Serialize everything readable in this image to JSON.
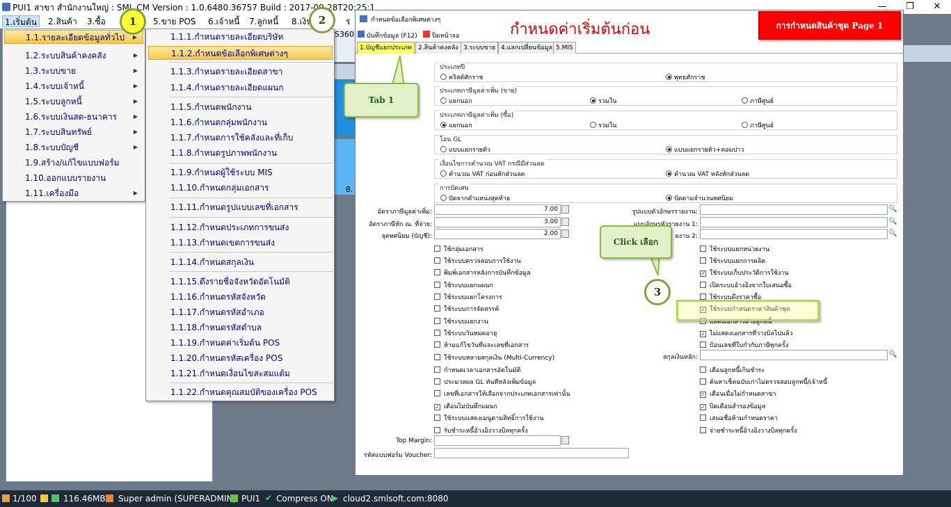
{
  "window": {
    "title": "PUI1 สาขา สำนักงานใหญ่ : SML CM Version : 1.0.6480.36757  Build : 2017-09-28T20:25:1"
  },
  "menubar": {
    "items": [
      {
        "label": "1.เริ่มต้น"
      },
      {
        "label": "2.สินค้า"
      },
      {
        "label": "3.ซื้อ"
      },
      {
        "label": "5.ขาย POS"
      },
      {
        "label": "6.เจ้าหนี้"
      },
      {
        "label": "7.ลูกหนี้"
      },
      {
        "label": "8.เงิน"
      },
      {
        "label": "ร"
      }
    ],
    "fragment": "S360"
  },
  "menu1": {
    "items": [
      {
        "label": "1.1.รายละเอียดข้อมูลทั่วไป",
        "sub": true
      },
      {
        "label": "1.2.ระบบสินค้าคงคลัง",
        "sub": true
      },
      {
        "label": "1.3.ระบบขาย",
        "sub": true
      },
      {
        "label": "1.4.ระบบเจ้าหนี้",
        "sub": true
      },
      {
        "label": "1.5.ระบบลูกหนี้",
        "sub": true
      },
      {
        "label": "1.6.ระบบเงินสด-ธนาคาร",
        "sub": true
      },
      {
        "label": "1.7.ระบบสินทรัพย์",
        "sub": true
      },
      {
        "label": "1.8.ระบบบัญชี",
        "sub": true
      },
      {
        "label": "1.9.สร้าง/แก้ไขแบบฟอร์ม",
        "sub": false
      },
      {
        "label": "1.10.ออกแบบรายงาน",
        "sub": false
      },
      {
        "label": "1.11.เครื่องมือ",
        "sub": true
      }
    ]
  },
  "menu2": {
    "items": [
      "1.1.1.กำหนดรายละเอียดบริษัท",
      "1.1.2.กำหนดข้อเลือกพิเศษต่างๆ",
      "1.1.3.กำหนดรายละเอียดสาขา",
      "1.1.4.กำหนดรายละเอียดแผนก",
      "1.1.5.กำหนดพนักงาน",
      "1.1.6.กำหนดกลุ่มพนักงาน",
      "1.1.7.กำหนดการใช้คลังและที่เก็บ",
      "1.1.8.กำหนดรูปภาพพนักงาน",
      "1.1.9.กำหนดผู้ใช้ระบบ MIS",
      "1.1.10.กำหนดกลุ่มเอกสาร",
      "1.1.11.กำหนดรูปแบบเลขที่เอกสาร",
      "1.1.12.กำหนดประเภทการขนส่ง",
      "1.1.13.กำหนดเขตการขนส่ง",
      "1.1.14.กำหนดสกุลเงิน",
      "1.1.15.ดึงรายชื่อจังหวัดอัตโนมัติ",
      "1.1.16.กำหนดรหัสจังหวัด",
      "1.1.17.กำหนดรหัสอำเภอ",
      "1.1.18.กำหนดรหัสตำบล",
      "1.1.19.กำหนดค่าเริ่มต้น POS",
      "1.1.20.กำหนดรหัสเครื่อง POS",
      "1.1.21.กำหนดเงื่อนไขสะสมแต้ม",
      "1.1.22.กำหนดคุณสมบัติของเครื่อง POS"
    ]
  },
  "background": {
    "label8": "8."
  },
  "dialog": {
    "title": "กำหนดข้อเลือกพิเศษต่างๆ",
    "big_title": "กำหนดค่าเริ่มต้นก่อน",
    "page_label": "การกำหนดสินค้าชุด  Page 1",
    "toolbar": {
      "save": "บันทึกข้อมูล (F12)",
      "close": "ปิดหน้าจอ"
    },
    "tabs": [
      "1.บัญชีแยกประเภท",
      "2.สินค้าคงคลัง",
      "3.ระบบขาย",
      "4.แลกเปลี่ยนข้อมูล",
      "5.MIS"
    ],
    "groups": [
      {
        "label": "ประเภทปี",
        "options": [
          "คริสต์ศักราช",
          "พุทธศักราช"
        ],
        "selected": 1
      },
      {
        "label": "ประเภทภาษีมูลค่าเพิ่ม (ขาย)",
        "options": [
          "แยกนอก",
          "รวมใน",
          "ภาษีศูนย์"
        ],
        "selected": 1
      },
      {
        "label": "ประเภทภาษีมูลค่าเพิ่ม (ซื้อ)",
        "options": [
          "แยกนอก",
          "รวมใน",
          "ภาษีศูนย์"
        ],
        "selected": 0
      },
      {
        "label": "โอน GL",
        "options": [
          "แบบแยกรายตัว",
          "แบบแยกรายตัว+คอมปาว"
        ],
        "selected": 1
      },
      {
        "label": "เงื่อนไขการคำนวณ VAT กรณีมีส่วนลด",
        "options": [
          "คำนวณ VAT ก่อนหักส่วนลด",
          "คำนวณ VAT หลังหักส่วนลด"
        ],
        "selected": 1
      },
      {
        "label": "การปัดเศษ",
        "options": [
          "ปัดจากตำแหน่งสุดท้าย",
          "ปัดตามจำนวนทศนิยม"
        ],
        "selected": 1
      }
    ],
    "fields": {
      "vat_rate_label": "อัตราภาษีมูลค่าเพิ่ม:",
      "vat_rate": "7.00",
      "wht_rate_label": "อัตราภาษีหัก ณ. ที่จ่าย:",
      "wht_rate": "3.00",
      "decimal_label": "จุดทศนิยม (บัญชี):",
      "decimal": "2.00",
      "report_font_label": "รูปแบบตัวอักษรรายงาน:",
      "header_font1_label": "แบบอักษรหัวรายงาน 1:",
      "header_font2_label": "ยงาน 2:",
      "currency_label": "สกุลเงินหลัก:",
      "top_margin_label": "Top Margin:",
      "voucher_label": "รหัสแบบฟอร์ม Voucher:"
    },
    "checks_left": [
      {
        "label": "ใช้กลุ่มเอกสาร",
        "checked": false
      },
      {
        "label": "ใช้ระบบตรวจสอบการใช้งาน",
        "checked": false
      },
      {
        "label": "พิมพ์เอกสารหลังการบันทึกข้อมูล",
        "checked": false
      },
      {
        "label": "ใช้ระบบแยกแผนก",
        "checked": false
      },
      {
        "label": "ใช้ระบบแยกโครงการ",
        "checked": false
      },
      {
        "label": "ใช้ระบบการจัดสรรค์",
        "checked": false
      },
      {
        "label": "ใช้ระบบแยกงาน",
        "checked": false
      },
      {
        "label": "ใช้ระบบวันหมดอายุ",
        "checked": false
      },
      {
        "label": "ห้ามแก้ไขวันที่และเลขที่เอกสาร",
        "checked": false
      },
      {
        "label": "ใช้ระบบหลายสกุลเงิน (Multi-Currency)",
        "checked": false
      },
      {
        "label": "กำหนดเวลาเอกสารอัตโนมัติ",
        "checked": false
      },
      {
        "label": "ประมวลผล GL ทันทีหลังเพิ่มข้อมูล",
        "checked": false
      },
      {
        "label": "เลขที่เอกสารให้เลือกจากประเภทเอกสารเท่านั้น",
        "checked": false
      },
      {
        "label": "เตือนไม่บันทึกแผนก",
        "checked": true
      },
      {
        "label": "ใช้ระบบแสดงเมนูตามสิทธิ์การใช้งาน",
        "checked": false
      },
      {
        "label": "รับชำระหนี้อ้างอิงวางบิลทุกครั้ง",
        "checked": false
      }
    ],
    "checks_right": [
      {
        "label": "ใช้ระบบแยกหน่วยงาน",
        "checked": false
      },
      {
        "label": "ใช้ระบบแยกการผลิต",
        "checked": false
      },
      {
        "label": "ใช้ระบบเก็บประวัติการใช้งาน",
        "checked": true
      },
      {
        "label": "เปิดระบบอ้างอิงจากใบเสนอซื้อ",
        "checked": false
      },
      {
        "label": "ใช้ระบบดึงราคาซื้อ",
        "checked": false
      },
      {
        "label": "ใช้ระบบกำหนดราคาสินค้าชุด",
        "checked": true
      },
      {
        "label": "แสดงเอกสารฝ่ายลูกหนี้",
        "checked": false
      },
      {
        "label": "ไม่แสดงเอกสารที่วางบิลไปแล้ว",
        "checked": true
      },
      {
        "label": "ป้อนเลขที่ใบกำกับภาษีทุกครั้ง",
        "checked": false
      },
      {
        "label": "เตือนลูกหนี้เกินชำระ",
        "checked": false
      },
      {
        "label": "ค้นหาเช็คฉบับเก่าไม่ตรวจสอบลูกหนี้/เจ้าหนี้",
        "checked": false
      },
      {
        "label": "เตือนเมื่อไม่กำหนดสาขา",
        "checked": true
      },
      {
        "label": "ปิดเตือนสำรองข้อมูล",
        "checked": true
      },
      {
        "label": "เสนอชื่อห้ามกำหนดราคา",
        "checked": false
      },
      {
        "label": "จ่ายชำระหนี้อ้างอิงวางบิลทุกครั้ง",
        "checked": false
      }
    ]
  },
  "annotations": {
    "step1": "1",
    "step2": "2",
    "step3": "3",
    "tab_callout": "Tab 1",
    "click_callout": "Click เลือก"
  },
  "statusbar": {
    "count": "1/100",
    "memory": "116.46MB",
    "user": "Super admin (SUPERADMIN)",
    "branch": "PUI1",
    "compress": "Compress ON",
    "server": "cloud2.smlsoft.com:8080"
  },
  "colors": {
    "menu_highlight": "#f7c84a",
    "tab_selected": "#ffff66",
    "title_red": "#e00000",
    "callout_green": "#8bbb40",
    "statusbar": "#1f2a38"
  }
}
